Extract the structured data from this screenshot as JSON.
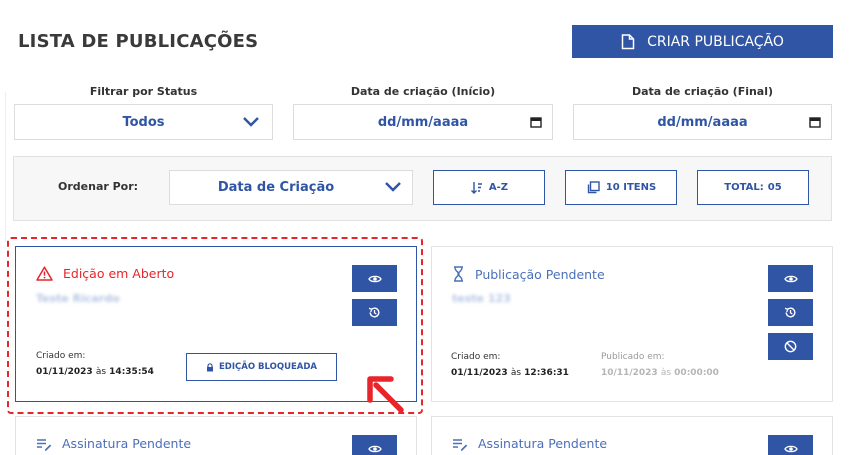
{
  "header": {
    "title": "LISTA DE PUBLICAÇÕES",
    "create_label": "CRIAR PUBLICAÇÃO"
  },
  "filters": {
    "status_label": "Filtrar por Status",
    "status_value": "Todos",
    "start_label": "Data de criação (Início)",
    "start_placeholder": "dd/mm/aaaa",
    "end_label": "Data de criação (Final)",
    "end_placeholder": "dd/mm/aaaa"
  },
  "order": {
    "label": "Ordenar Por:",
    "value": "Data de Criação",
    "sort_label": "A-Z",
    "items_label": "10 ITENS",
    "total_label": "TOTAL:",
    "total_value": "05"
  },
  "cards": [
    {
      "status": "Edição em Aberto",
      "status_color": "#e6252b",
      "status_icon": "warning-icon",
      "name": "Teste Ricardo",
      "created_label": "Criado em:",
      "created_date": "01/11/2023",
      "created_sep": "às",
      "created_time": "14:35:54",
      "locked_label": "EDIÇÃO BLOQUEADA"
    },
    {
      "status": "Publicação Pendente",
      "status_color": "#4b6fb8",
      "status_icon": "hourglass-icon",
      "name": "teste 123",
      "created_label": "Criado em:",
      "created_date": "01/11/2023",
      "created_sep": "às",
      "created_time": "12:36:31",
      "published_label": "Publicado em:",
      "published_date": "10/11/2023",
      "published_sep": "às",
      "published_time": "00:00:00"
    },
    {
      "status": "Assinatura Pendente",
      "status_color": "#4b6fb8",
      "status_icon": "signature-icon"
    },
    {
      "status": "Assinatura Pendente",
      "status_color": "#4b6fb8",
      "status_icon": "signature-icon"
    }
  ],
  "accent_color": "#2f55a4",
  "highlight_color": "#e8252a"
}
